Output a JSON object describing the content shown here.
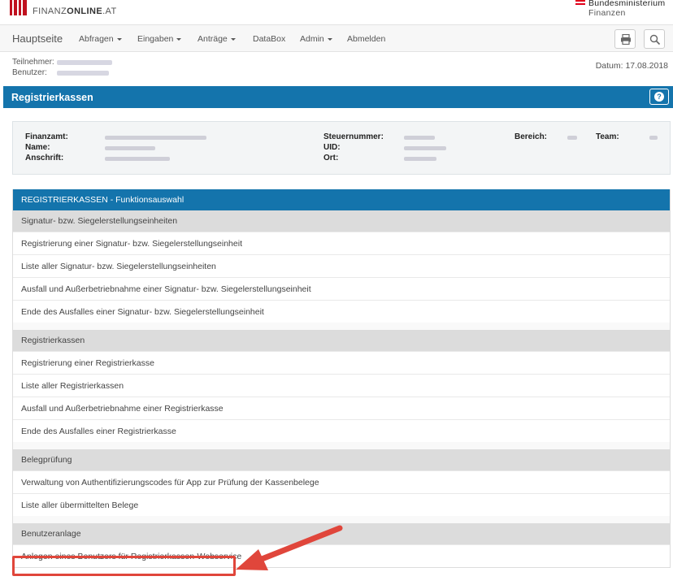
{
  "brand": {
    "logo_text_light": "FINANZ",
    "logo_text_bold": "ONLINE",
    "logo_text_tail": ".AT",
    "ministry_line1": "Bundesministerium",
    "ministry_line2": "Finanzen"
  },
  "nav": {
    "home": "Hauptseite",
    "items": [
      "Abfragen",
      "Eingaben",
      "Anträge",
      "DataBox",
      "Admin",
      "Abmelden"
    ],
    "print_icon": "printer-icon",
    "search_icon": "search-icon"
  },
  "participant": {
    "teilnehmer_label": "Teilnehmer:",
    "benutzer_label": "Benutzer:",
    "datum": "Datum: 17.08.2018"
  },
  "page": {
    "title": "Registrierkassen",
    "help_icon": "question-circle-icon"
  },
  "infobox": {
    "finanzamt_label": "Finanzamt:",
    "name_label": "Name:",
    "anschrift_label": "Anschrift:",
    "steuernummer_label": "Steuernummer:",
    "uid_label": "UID:",
    "ort_label": "Ort:",
    "bereich_label": "Bereich:",
    "team_label": "Team:"
  },
  "functions": {
    "header": "REGISTRIERKASSEN - Funktionsauswahl",
    "sections": [
      {
        "title": "Signatur- bzw. Siegelerstellungseinheiten",
        "items": [
          "Registrierung einer Signatur- bzw. Siegelerstellungseinheit",
          "Liste aller Signatur- bzw. Siegelerstellungseinheiten",
          "Ausfall und Außerbetriebnahme einer Signatur- bzw. Siegelerstellungseinheit",
          "Ende des Ausfalles einer Signatur- bzw. Siegelerstellungseinheit"
        ]
      },
      {
        "title": "Registrierkassen",
        "items": [
          "Registrierung einer Registrierkasse",
          "Liste aller Registrierkassen",
          "Ausfall und Außerbetriebnahme einer Registrierkasse",
          "Ende des Ausfalles einer Registrierkasse"
        ]
      },
      {
        "title": "Belegprüfung",
        "items": [
          "Verwaltung von Authentifizierungscodes für App zur Prüfung der Kassenbelege",
          "Liste aller übermittelten Belege"
        ]
      },
      {
        "title": "Benutzeranlage",
        "items": [
          "Anlegen eines Benutzers für Registrierkassen-Webservice"
        ]
      }
    ]
  },
  "colors": {
    "primary_blue": "#1474ac",
    "brand_red": "#c0111f",
    "annotation_red": "#e0463b"
  }
}
